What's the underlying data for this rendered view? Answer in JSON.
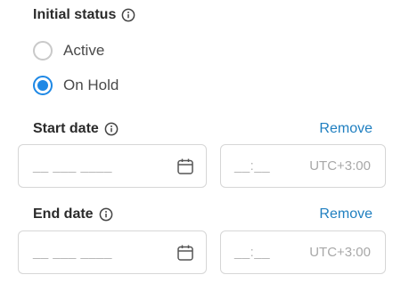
{
  "status": {
    "heading": "Initial status",
    "options": [
      {
        "label": "Active",
        "checked": false
      },
      {
        "label": "On Hold",
        "checked": true
      }
    ]
  },
  "start": {
    "heading": "Start date",
    "remove": "Remove",
    "date_placeholder": "__ ___ ____",
    "time_placeholder": "__:__",
    "timezone": "UTC+3:00"
  },
  "end": {
    "heading": "End date",
    "remove": "Remove",
    "date_placeholder": "__ ___ ____",
    "time_placeholder": "__:__",
    "timezone": "UTC+3:00"
  },
  "colors": {
    "accent": "#1e88e5",
    "link": "#1f7fc0"
  }
}
